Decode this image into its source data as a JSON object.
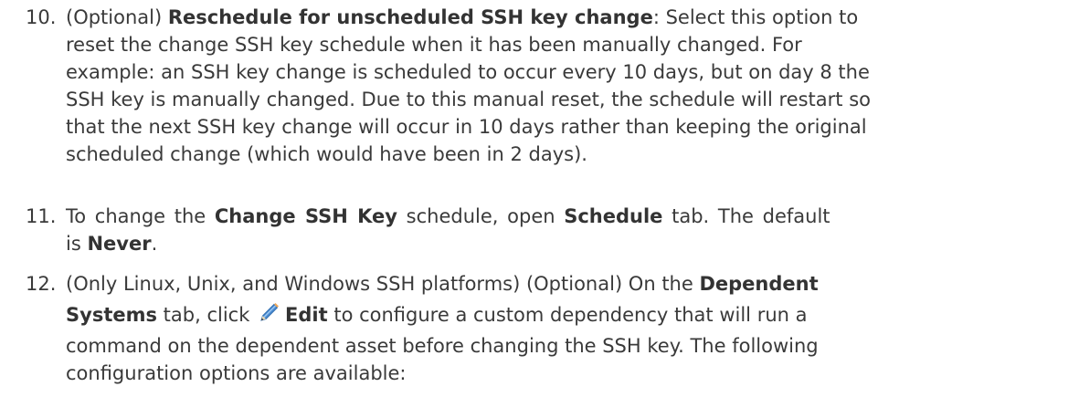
{
  "steps": [
    {
      "number": "10.",
      "prefix": "(Optional) ",
      "title": "Reschedule for unscheduled SSH key change",
      "text_lines": [
        ": Select this option to",
        "reset the change SSH key schedule when it has been manually changed. For",
        "example: an SSH key change is scheduled to occur every 10 days, but on day 8 the",
        "SSH key is manually changed. Due to this manual reset, the schedule will restart so",
        "that the next SSH key change will occur in 10 days rather than keeping the original",
        "scheduled change (which would have been in 2 days)."
      ]
    },
    {
      "number": "11.",
      "t1": " To change the ",
      "b1": "Change SSH Key",
      "t2": " schedule, open ",
      "b2": "Schedule",
      "t3": " tab. The default",
      "t4": "is ",
      "b3": "Never",
      "t5": "."
    },
    {
      "number": "12.",
      "t1": "(Only Linux, Unix, and Windows SSH platforms) (Optional) On the ",
      "b1": "Dependent",
      "b2": "Systems",
      "t2": " tab, click ",
      "icon": "pencil-edit-icon",
      "b3": "Edit",
      "t3": " to configure a custom dependency that will run a",
      "line3": "command on the dependent asset before changing the SSH key. The following",
      "line4": "configuration options are available:"
    }
  ]
}
